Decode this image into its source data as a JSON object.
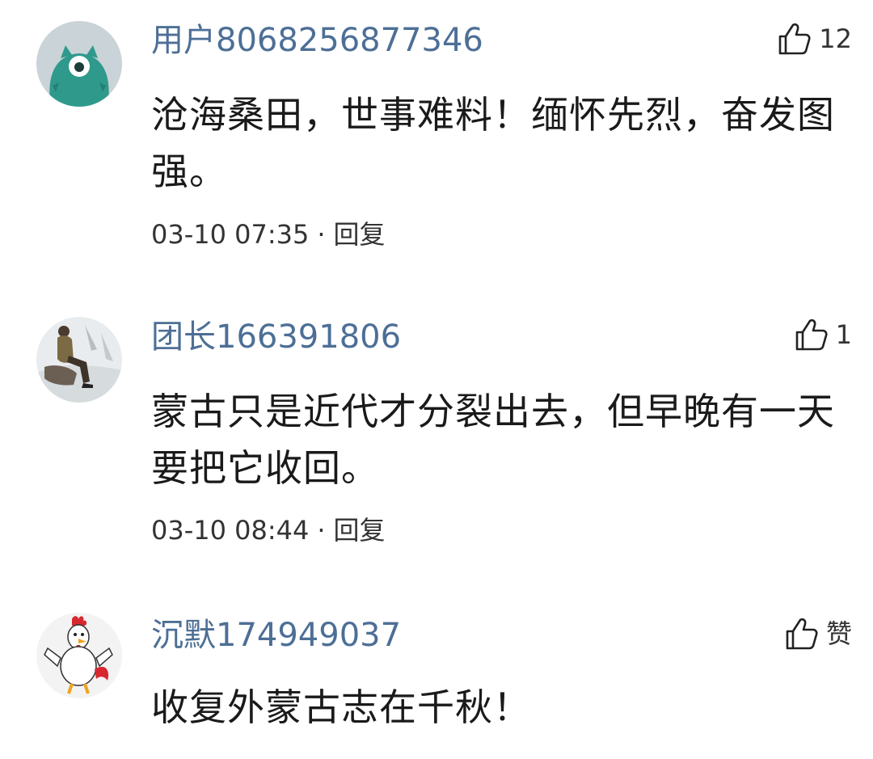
{
  "comments": [
    {
      "username": "用户8068256877346",
      "likes": "12",
      "text": "沧海桑田，世事难料！缅怀先烈，奋发图强。",
      "time": "03-10 07:35",
      "separator": "·",
      "reply_label": "回复",
      "avatar_icon": "green-monster-icon"
    },
    {
      "username": "团长166391806",
      "likes": "1",
      "text": "蒙古只是近代才分裂出去，但早晚有一天要把它收回。",
      "time": "03-10 08:44",
      "separator": "·",
      "reply_label": "回复",
      "avatar_icon": "person-sitting-photo"
    },
    {
      "username": "沉默174949037",
      "likes": "赞",
      "text": "收复外蒙古志在千秋！",
      "time": "",
      "separator": "",
      "reply_label": "",
      "avatar_icon": "cartoon-rooster-icon"
    }
  ],
  "colors": {
    "username": "#4d6f96",
    "text": "#1a1a1a",
    "meta": "#333333"
  }
}
